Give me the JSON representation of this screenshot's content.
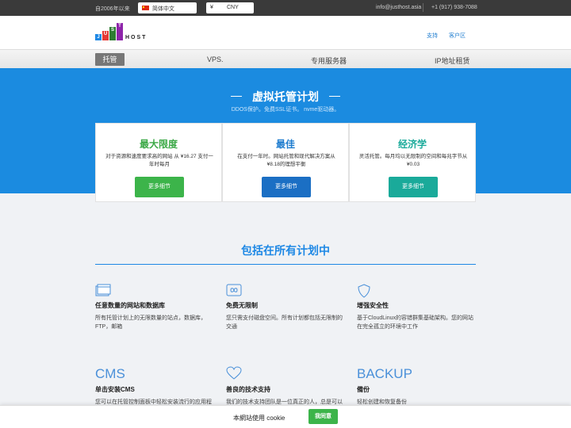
{
  "topbar": {
    "since": "自2006年以来",
    "language": "简体中文",
    "currency_symbol": "¥",
    "currency_code": "CNY",
    "email": "info@justhost.asia",
    "phone": "+1 (917) 938-7088"
  },
  "header": {
    "logo_letters": [
      "J",
      "U",
      "S",
      "T"
    ],
    "logo_suffix": "HOST",
    "support": "支持",
    "client_area": "客户区"
  },
  "nav": {
    "items": [
      "托管",
      "VPS.",
      "专用服务器",
      "IP地址租赁"
    ]
  },
  "hero": {
    "title": "虚拟托管计划",
    "subtitle": "DDOS保护。免费SSL证书。 nvme驱动器。"
  },
  "plans": [
    {
      "title": "最大限度",
      "desc": "对于资源和速度要求高的网站 从 ¥16.27 支付一年时每月",
      "button": "更多细节",
      "color": "#3cb44a",
      "title_color": "#3aa845"
    },
    {
      "title": "最佳",
      "desc": "在支付一年时。网站托管和现代解决方案从 ¥8.18的理想平衡",
      "button": "更多细节",
      "color": "#1b6fc4",
      "title_color": "#1e7ccf"
    },
    {
      "title": "经济学",
      "desc": "灵活托管。每月均以无限制的空间和每兆字节从 ¥0.03",
      "button": "更多细节",
      "color": "#1aaa9a",
      "title_color": "#1aaa9a"
    }
  ],
  "features": {
    "title": "包括在所有计划中",
    "items": [
      {
        "icon": "browser-window-icon",
        "title": "任意数量的网站和数据库",
        "desc": "所有托管计划上的无限数量的站点，数据库，FTP，邮箱"
      },
      {
        "icon": "infinity-icon",
        "title": "免费无限制",
        "desc": "您只需支付磁盘空间。所有计划都包括无限制的交通"
      },
      {
        "icon": "shield-icon",
        "title": "增强安全性",
        "desc": "基于CloudLinux的容错群集基础架构。您的网站在完全孤立的环境中工作"
      },
      {
        "icon_text": "CMS",
        "title": "单击安装CMS",
        "desc": "您可以在托管控制面板中轻松安装流行的应用程"
      },
      {
        "icon": "heart-icon",
        "title": "善良的技术支持",
        "desc": "我们的技术支持团队是一位真正的人，总是可以"
      },
      {
        "icon_text": "BACKUP",
        "title": "備份",
        "desc": "轻松创建和恢复备份"
      }
    ]
  },
  "cookie": {
    "text": "本網站使用 cookie",
    "button": "我同意"
  }
}
